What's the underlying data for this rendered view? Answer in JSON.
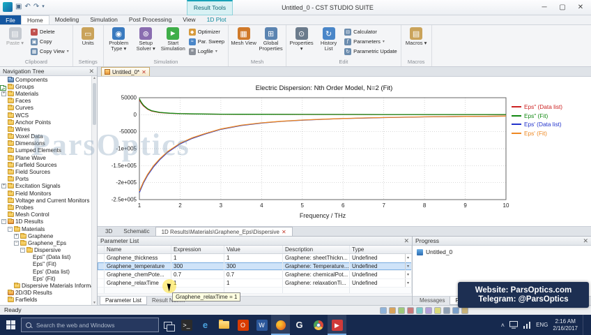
{
  "window": {
    "title": "Untitled_0 - CST STUDIO SUITE",
    "context_tab": "Result Tools"
  },
  "ribbon": {
    "file_tab": "File",
    "tabs": [
      {
        "label": "Home",
        "active": true
      },
      {
        "label": "Modeling"
      },
      {
        "label": "Simulation"
      },
      {
        "label": "Post Processing"
      },
      {
        "label": "View"
      },
      {
        "label": "1D Plot",
        "contextual": true
      }
    ],
    "groups": [
      {
        "label": "Clipboard",
        "bigs": [
          {
            "label": "Paste",
            "glyph": "▤",
            "color": "#8e98a4",
            "arrow": true,
            "disabled": true
          }
        ],
        "smalls": [
          {
            "label": "Delete",
            "glyph": "×",
            "color": "#c0504d"
          },
          {
            "label": "Copy",
            "glyph": "▣",
            "color": "#6b8cae"
          },
          {
            "label": "Copy View",
            "glyph": "▦",
            "color": "#6b8cae",
            "arrow": true
          }
        ]
      },
      {
        "label": "Settings",
        "bigs": [
          {
            "label": "Units",
            "glyph": "▭",
            "color": "#caa35a"
          }
        ],
        "smalls": []
      },
      {
        "label": "Simulation",
        "bigs": [
          {
            "label": "Problem Type",
            "glyph": "◉",
            "color": "#3a7abf",
            "arrow": true
          },
          {
            "label": "Setup Solver",
            "glyph": "⊛",
            "color": "#8a6db0",
            "arrow": true
          },
          {
            "label": "Start Simulation",
            "glyph": "►",
            "color": "#3fae49"
          }
        ],
        "smalls": [
          {
            "label": "Optimizer",
            "glyph": "◆",
            "color": "#d69a3c"
          },
          {
            "label": "Par. Sweep",
            "glyph": "≈",
            "color": "#4a86c8"
          },
          {
            "label": "Logfile",
            "glyph": "≡",
            "color": "#8a8f98",
            "arrow": true
          }
        ]
      },
      {
        "label": "Mesh",
        "bigs": [
          {
            "label": "Mesh View",
            "glyph": "▦",
            "color": "#d07a2a"
          },
          {
            "label": "Global Properties",
            "glyph": "⊞",
            "color": "#5b84b1"
          }
        ],
        "smalls": []
      },
      {
        "label": "Edit",
        "bigs": [
          {
            "label": "Properties",
            "glyph": "⊙",
            "color": "#6b7b8c",
            "arrow": true
          },
          {
            "label": "History List",
            "glyph": "↻",
            "color": "#4a86c8"
          }
        ],
        "smalls": [
          {
            "label": "Calculator",
            "glyph": "⊟",
            "color": "#6b8cae"
          },
          {
            "label": "Parameters",
            "glyph": "ƒ",
            "color": "#6b8cae",
            "arrow": true
          },
          {
            "label": "Parametric Update",
            "glyph": "↻",
            "color": "#6b8cae"
          }
        ]
      },
      {
        "label": "Macros",
        "bigs": [
          {
            "label": "Macros",
            "glyph": "▤",
            "color": "#caa35a",
            "arrow": true
          }
        ],
        "smalls": []
      }
    ]
  },
  "nav_tree": {
    "title": "Navigation Tree",
    "items": [
      {
        "label": "Components",
        "lvl": 0,
        "icon": "cube"
      },
      {
        "label": "Groups",
        "lvl": 0,
        "icon": "folder"
      },
      {
        "label": "Materials",
        "lvl": 0,
        "icon": "folder",
        "expand": "plus"
      },
      {
        "label": "Faces",
        "lvl": 0,
        "icon": "folder"
      },
      {
        "label": "Curves",
        "lvl": 0,
        "icon": "folder"
      },
      {
        "label": "WCS",
        "lvl": 0,
        "icon": "folder"
      },
      {
        "label": "Anchor Points",
        "lvl": 0,
        "icon": "folder"
      },
      {
        "label": "Wires",
        "lvl": 0,
        "icon": "folder"
      },
      {
        "label": "Voxel Data",
        "lvl": 0,
        "icon": "folder"
      },
      {
        "label": "Dimensions",
        "lvl": 0,
        "icon": "folder"
      },
      {
        "label": "Lumped Elements",
        "lvl": 0,
        "icon": "folder"
      },
      {
        "label": "Plane Wave",
        "lvl": 0,
        "icon": "folder"
      },
      {
        "label": "Farfield Sources",
        "lvl": 0,
        "icon": "folder"
      },
      {
        "label": "Field Sources",
        "lvl": 0,
        "icon": "folder"
      },
      {
        "label": "Ports",
        "lvl": 0,
        "icon": "folder"
      },
      {
        "label": "Excitation Signals",
        "lvl": 0,
        "icon": "folder",
        "expand": "plus"
      },
      {
        "label": "Field Monitors",
        "lvl": 0,
        "icon": "folder"
      },
      {
        "label": "Voltage and Current Monitors",
        "lvl": 0,
        "icon": "folder"
      },
      {
        "label": "Probes",
        "lvl": 0,
        "icon": "folder"
      },
      {
        "label": "Mesh Control",
        "lvl": 0,
        "icon": "folder"
      },
      {
        "label": "1D Results",
        "lvl": 0,
        "icon": "results",
        "expand": "minus"
      },
      {
        "label": "Materials",
        "lvl": 1,
        "icon": "folder",
        "expand": "minus"
      },
      {
        "label": "Graphene",
        "lvl": 2,
        "icon": "folder",
        "expand": "plus"
      },
      {
        "label": "Graphene_Eps",
        "lvl": 2,
        "icon": "folder",
        "expand": "minus"
      },
      {
        "label": "Dispersive",
        "lvl": 3,
        "icon": "folder",
        "expand": "minus"
      },
      {
        "label": "Eps\" (Data list)",
        "lvl": 4,
        "icon": "chart"
      },
      {
        "label": "Eps\" (Fit)",
        "lvl": 4,
        "icon": "chart"
      },
      {
        "label": "Eps' (Data list)",
        "lvl": 4,
        "icon": "chart"
      },
      {
        "label": "Eps' (Fit)",
        "lvl": 4,
        "icon": "chart"
      },
      {
        "label": "Dispersive Materials Informatic",
        "lvl": 1,
        "icon": "folder"
      },
      {
        "label": "2D/3D Results",
        "lvl": 0,
        "icon": "results"
      },
      {
        "label": "Farfields",
        "lvl": 0,
        "icon": "folder"
      }
    ]
  },
  "document_tab": {
    "label": "Untitled_0*"
  },
  "chart_data": {
    "type": "line",
    "title": "Electric Dispersion: Nth Order Model, N=2 (Fit)",
    "xlabel": "Frequency / THz",
    "ylabel": "",
    "xlim": [
      1,
      10
    ],
    "ylim": [
      -250000,
      50000
    ],
    "xticks": [
      1,
      2,
      3,
      4,
      5,
      6,
      7,
      8,
      9,
      10
    ],
    "yticks": [
      50000,
      0,
      -50000,
      -100000,
      -150000,
      -200000,
      -250000
    ],
    "ytick_labels": [
      "50000",
      "0",
      "-50000",
      "-1e+005",
      "-1.5e+005",
      "-2e+005",
      "-2.5e+005"
    ],
    "grid": true,
    "legend_position": "right",
    "series": [
      {
        "name": "Eps\" (Data list)",
        "color": "#cc2222",
        "x": [
          1,
          1.05,
          1.1,
          1.2,
          1.3,
          1.5,
          1.75,
          2,
          2.5,
          3,
          3.5,
          4,
          5,
          6,
          7,
          8,
          9,
          10
        ],
        "y": [
          44000,
          33500,
          26000,
          16200,
          10800,
          6200,
          4000,
          2900,
          1900,
          1450,
          1180,
          1000,
          750,
          600,
          510,
          440,
          390,
          350
        ]
      },
      {
        "name": "Eps\" (Fit)",
        "color": "#118811",
        "x": [
          1,
          1.05,
          1.1,
          1.2,
          1.3,
          1.5,
          1.75,
          2,
          2.5,
          3,
          3.5,
          4,
          5,
          6,
          7,
          8,
          9,
          10
        ],
        "y": [
          47000,
          36000,
          28000,
          17500,
          11800,
          6800,
          4400,
          3200,
          2100,
          1600,
          1300,
          1100,
          820,
          660,
          560,
          480,
          420,
          380
        ]
      },
      {
        "name": "Eps' (Data list)",
        "color": "#2233cc",
        "x": [
          1,
          1.1,
          1.2,
          1.35,
          1.5,
          1.7,
          2,
          2.3,
          2.6,
          3,
          3.5,
          4,
          4.5,
          5,
          5.5,
          6,
          6.5,
          7,
          7.5,
          8,
          8.5,
          9,
          9.5,
          10
        ],
        "y": [
          -229000,
          -201000,
          -179000,
          -153000,
          -132500,
          -110000,
          -86000,
          -69500,
          -57200,
          -43000,
          -31800,
          -24600,
          -19700,
          -16200,
          -13600,
          -11500,
          -9900,
          -8600,
          -7500,
          -6600,
          -5900,
          -5300,
          -4800,
          -4300
        ]
      },
      {
        "name": "Eps' (Fit)",
        "color": "#ee8822",
        "x": [
          1,
          1.1,
          1.2,
          1.35,
          1.5,
          1.7,
          2,
          2.3,
          2.6,
          3,
          3.5,
          4,
          4.5,
          5,
          5.5,
          6,
          6.5,
          7,
          7.5,
          8,
          8.5,
          9,
          9.5,
          10
        ],
        "y": [
          -225000,
          -198000,
          -176000,
          -150000,
          -130000,
          -108000,
          -84000,
          -68000,
          -56000,
          -42000,
          -31000,
          -24000,
          -19200,
          -15800,
          -13200,
          -11200,
          -9600,
          -8300,
          -7300,
          -6400,
          -5700,
          -5100,
          -4600,
          -4100
        ]
      }
    ]
  },
  "view_tabs": [
    {
      "label": "3D"
    },
    {
      "label": "Schematic"
    },
    {
      "label": "1D Results\\Materials\\Graphene_Eps\\Dispersive",
      "active": true,
      "closable": true
    }
  ],
  "parameter_list": {
    "title": "Parameter List",
    "columns": [
      "Name",
      "Expression",
      "Value",
      "Description",
      "Type"
    ],
    "rows": [
      {
        "name": "Graphene_thickness",
        "expression": "1",
        "value": "1",
        "description": "Graphene: sheetThickn...",
        "type": "Undefined",
        "selected": false
      },
      {
        "name": "Graphene_temperature",
        "expression": "300",
        "value": "300",
        "description": "Graphene: Temperature...",
        "type": "Undefined",
        "selected": true
      },
      {
        "name": "Graphene_chemPote...",
        "expression": "0.7",
        "value": "0.7",
        "description": "Graphene: chemicalPot...",
        "type": "Undefined",
        "selected": false
      },
      {
        "name": "Graphene_relaxTime",
        "expression": "1",
        "value": "1",
        "description": "Graphene: relaxationTi...",
        "type": "Undefined",
        "selected": false
      }
    ],
    "tabs": [
      {
        "label": "Parameter List",
        "active": true
      },
      {
        "label": "Result Navi..."
      }
    ]
  },
  "tooltip": "Graphene_relaxTime = 1",
  "progress": {
    "title": "Progress",
    "item": "Untitled_0",
    "tabs": [
      {
        "label": "Messages"
      },
      {
        "label": "Progress",
        "active": true
      }
    ]
  },
  "status_bar": {
    "ready": "Ready",
    "icons": [
      "#8fb3d9",
      "#d9a35a",
      "#9fc97a",
      "#c97a7a",
      "#7ac9c9",
      "#b39fd9",
      "#d9d97a",
      "#8fa0b3",
      "#7a9fc9",
      "#c9b37a"
    ]
  },
  "taskbar": {
    "search_placeholder": "Search the web and Windows",
    "icons": [
      {
        "name": "cmd",
        "glyph": ">_",
        "bg": "#2b2b2b",
        "fg": "#ffffff"
      },
      {
        "name": "edge",
        "glyph": "e",
        "fg": "#4aa3e0"
      },
      {
        "name": "file-explorer"
      },
      {
        "name": "office",
        "glyph": "O",
        "bg": "#d83b01",
        "fg": "#ffffff"
      },
      {
        "name": "word",
        "glyph": "W",
        "bg": "#2b579a",
        "fg": "#ffffff"
      },
      {
        "name": "firefox",
        "active": true
      },
      {
        "name": "google",
        "glyph": "G",
        "fg": "#f0f0f0"
      },
      {
        "name": "chrome"
      },
      {
        "name": "youtube",
        "glyph": "▶",
        "bg": "#d03a3a",
        "fg": "#ffffff",
        "active": true
      }
    ],
    "tray": {
      "lang": "ENG",
      "time": "2:16 AM",
      "date": "2/16/2017"
    }
  },
  "watermark": {
    "big": "ParsOptics",
    "line1": "Website: ParsOptics.com",
    "line2": "Telegram: @ParsOptics"
  }
}
